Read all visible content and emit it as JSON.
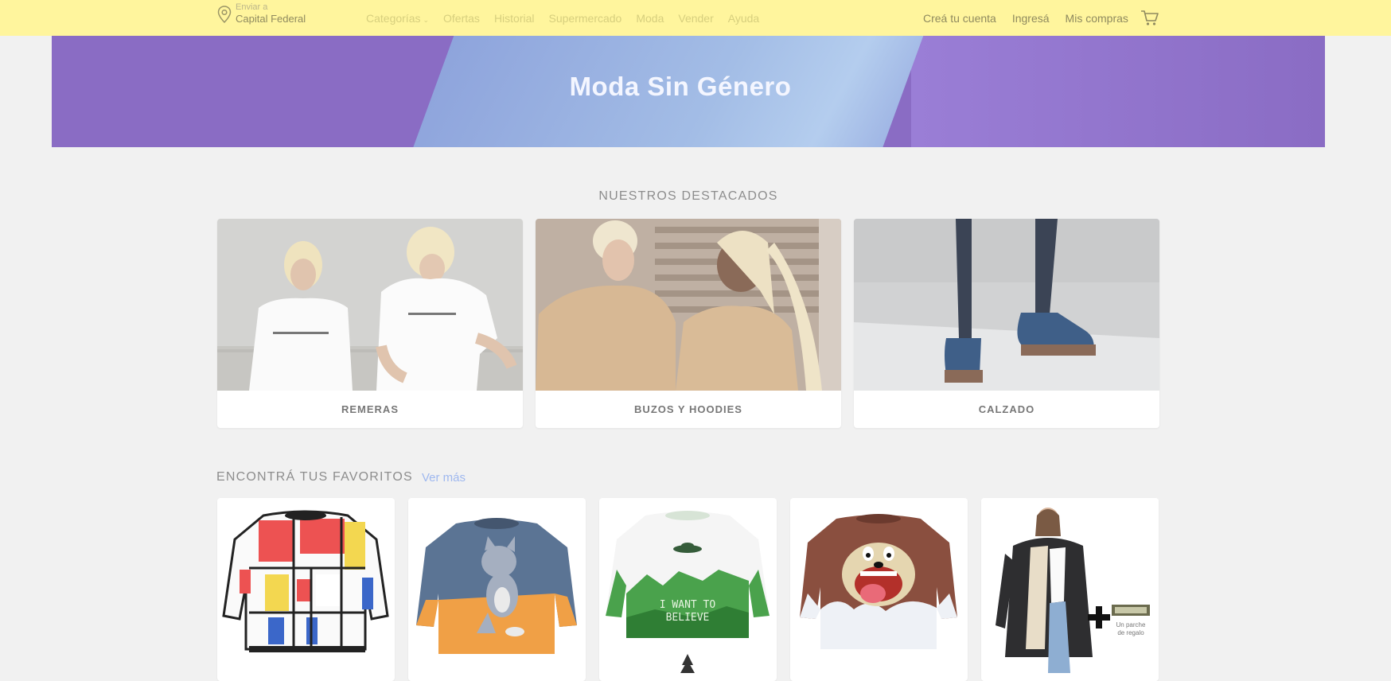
{
  "header": {
    "location_label": "Enviar a",
    "location_value": "Capital Federal",
    "nav": [
      "Categorías",
      "Ofertas",
      "Historial",
      "Supermercado",
      "Moda",
      "Vender",
      "Ayuda"
    ],
    "account": [
      "Creá tu cuenta",
      "Ingresá",
      "Mis compras"
    ]
  },
  "hero": {
    "title": "Moda Sin Género"
  },
  "featured": {
    "title": "NUESTROS DESTACADOS",
    "cards": [
      {
        "label": "REMERAS"
      },
      {
        "label": "BUZOS Y HOODIES"
      },
      {
        "label": "CALZADO"
      }
    ]
  },
  "favorites": {
    "title": "ENCONTRÁ TUS FAVORITOS",
    "more_link": "Ver más",
    "product_3_print": "I WANT TO BELIEVE",
    "product_5_promo": "Un parche de regalo"
  },
  "colors": {
    "topbar": "#fff59d",
    "hero_purple": "#8a6cc4",
    "hero_blue": "#9fb5e4",
    "page_bg": "#f1f1f1"
  }
}
